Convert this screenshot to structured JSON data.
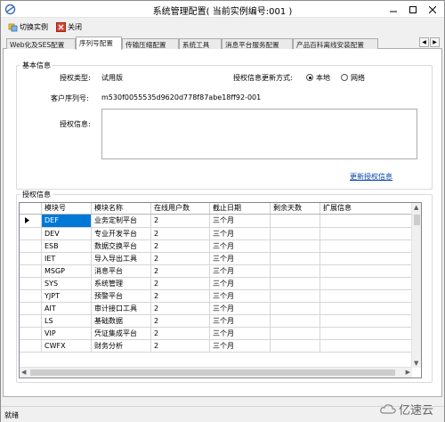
{
  "window": {
    "title": "系统管理配置( 当前实例编号:001 )"
  },
  "toolbar": {
    "switch_label": "切换实例",
    "close_label": "关闭"
  },
  "tabs": [
    {
      "label": "Web化及SES配置"
    },
    {
      "label": "序列号配置"
    },
    {
      "label": "传输压缩配置"
    },
    {
      "label": "系统工具"
    },
    {
      "label": "消息平台服务配置"
    },
    {
      "label": "产品百科离线安装配置"
    }
  ],
  "basic": {
    "group_title": "基本信息",
    "auth_type_label": "授权类型:",
    "auth_type_value": "试用版",
    "update_mode_label": "授权信息更新方式:",
    "update_modes": [
      {
        "label": "本地",
        "checked": true
      },
      {
        "label": "网络",
        "checked": false
      }
    ],
    "serial_label": "客户序列号:",
    "serial_value": "m530f0055535d9620d778f87abe18ff92-001",
    "auth_info_label": "授权信息:",
    "update_link": "更新授权信息"
  },
  "auth": {
    "group_title": "授权信息",
    "columns": [
      "模块号",
      "模块名称",
      "在线用户数",
      "截止日期",
      "剩余天数",
      "扩展信息"
    ],
    "rows": [
      [
        "DEF",
        "业务定制平台",
        "2",
        "三个月",
        "",
        ""
      ],
      [
        "DEV",
        "专业开发平台",
        "2",
        "三个月",
        "",
        ""
      ],
      [
        "ESB",
        "数据交换平台",
        "2",
        "三个月",
        "",
        ""
      ],
      [
        "IET",
        "导入导出工具",
        "2",
        "三个月",
        "",
        ""
      ],
      [
        "MSGP",
        "消息平台",
        "2",
        "三个月",
        "",
        ""
      ],
      [
        "SYS",
        "系统管理",
        "2",
        "三个月",
        "",
        ""
      ],
      [
        "YJPT",
        "预警平台",
        "2",
        "三个月",
        "",
        ""
      ],
      [
        "AIT",
        "审计接口工具",
        "2",
        "三个月",
        "",
        ""
      ],
      [
        "LS",
        "基础数据",
        "2",
        "三个月",
        "",
        ""
      ],
      [
        "VIP",
        "凭证集成平台",
        "2",
        "三个月",
        "",
        ""
      ],
      [
        "CWFX",
        "财务分析",
        "2",
        "三个月",
        "",
        ""
      ]
    ]
  },
  "status": {
    "text": "就绪"
  },
  "watermark": {
    "text": "亿速云"
  }
}
